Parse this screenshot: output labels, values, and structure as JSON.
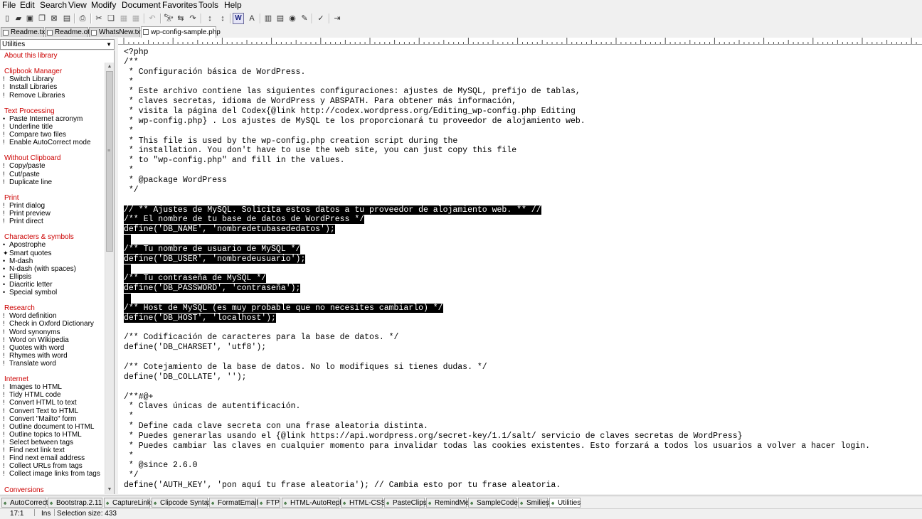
{
  "menu": [
    "File",
    "Edit",
    "Search",
    "View",
    "Modify",
    "Document",
    "Favorites",
    "Tools",
    "Help"
  ],
  "toolbar_icons": [
    "new-icon",
    "open-icon",
    "save-icon",
    "save-all-icon",
    "close-icon",
    "clipboard-icon",
    "print-icon",
    "cut-icon",
    "copy-icon",
    "paste-icon",
    "paste-special-icon",
    "undo-icon",
    "find-icon",
    "find-replace-icon",
    "find-next-icon",
    "sort-ascending-icon",
    "sort-descending-icon",
    "word-wrap-icon",
    "font-size-icon",
    "library-icon",
    "clipbook-icon",
    "web-icon",
    "edit-icon",
    "spell-check-icon",
    "exit-icon"
  ],
  "tabs": [
    "Readme.txt",
    "Readme.otl",
    "WhatsNew.txt",
    "wp-config-sample.php"
  ],
  "library": {
    "selected": "Utilities",
    "items": [
      {
        "type": "section",
        "text": "About this library"
      },
      {
        "type": "gap"
      },
      {
        "type": "section",
        "text": "Clipbook Manager"
      },
      {
        "type": "item",
        "bullet": "!",
        "text": "Switch Library"
      },
      {
        "type": "item",
        "bullet": "!",
        "text": "Install Libraries"
      },
      {
        "type": "item",
        "bullet": "!",
        "text": "Remove Libraries"
      },
      {
        "type": "gap"
      },
      {
        "type": "section",
        "text": "Text Processing"
      },
      {
        "type": "item",
        "bullet": "•",
        "text": "Paste Internet acronym"
      },
      {
        "type": "item",
        "bullet": "!",
        "text": "Underline title"
      },
      {
        "type": "item",
        "bullet": "!",
        "text": "Compare two files"
      },
      {
        "type": "item",
        "bullet": "!",
        "text": "Enable AutoCorrect mode"
      },
      {
        "type": "gap"
      },
      {
        "type": "section",
        "text": "Without Clipboard"
      },
      {
        "type": "item",
        "bullet": "!",
        "text": "Copy/paste"
      },
      {
        "type": "item",
        "bullet": "!",
        "text": "Cut/paste"
      },
      {
        "type": "item",
        "bullet": "!",
        "text": "Duplicate line"
      },
      {
        "type": "gap"
      },
      {
        "type": "section",
        "text": "Print"
      },
      {
        "type": "item",
        "bullet": "!",
        "text": "Print dialog"
      },
      {
        "type": "item",
        "bullet": "!",
        "text": "Print preview"
      },
      {
        "type": "item",
        "bullet": "!",
        "text": "Print direct"
      },
      {
        "type": "gap"
      },
      {
        "type": "section",
        "text": "Characters & symbols"
      },
      {
        "type": "item",
        "bullet": "•",
        "text": "Apostrophe"
      },
      {
        "type": "item",
        "bullet": "✦",
        "text": "Smart quotes"
      },
      {
        "type": "item",
        "bullet": "•",
        "text": "M-dash"
      },
      {
        "type": "item",
        "bullet": "•",
        "text": "N-dash (with spaces)"
      },
      {
        "type": "item",
        "bullet": "•",
        "text": "Ellipsis"
      },
      {
        "type": "item",
        "bullet": "•",
        "text": "Diacritic letter"
      },
      {
        "type": "item",
        "bullet": "•",
        "text": "Special symbol"
      },
      {
        "type": "gap"
      },
      {
        "type": "section",
        "text": "Research"
      },
      {
        "type": "item",
        "bullet": "!",
        "text": "Word definition"
      },
      {
        "type": "item",
        "bullet": "!",
        "text": "Check in Oxford Dictionary"
      },
      {
        "type": "item",
        "bullet": "!",
        "text": "Word synonyms"
      },
      {
        "type": "item",
        "bullet": "!",
        "text": "Word on Wikipedia"
      },
      {
        "type": "item",
        "bullet": "!",
        "text": "Quotes with word"
      },
      {
        "type": "item",
        "bullet": "!",
        "text": "Rhymes with word"
      },
      {
        "type": "item",
        "bullet": "!",
        "text": "Translate word"
      },
      {
        "type": "gap"
      },
      {
        "type": "section",
        "text": "Internet"
      },
      {
        "type": "item",
        "bullet": "!",
        "text": "Images to HTML"
      },
      {
        "type": "item",
        "bullet": "!",
        "text": "Tidy HTML code"
      },
      {
        "type": "item",
        "bullet": "!",
        "text": "Convert HTML to text"
      },
      {
        "type": "item",
        "bullet": "!",
        "text": "Convert Text to HTML"
      },
      {
        "type": "item",
        "bullet": "!",
        "text": "Convert \"Mailto\" form"
      },
      {
        "type": "item",
        "bullet": "!",
        "text": "Outline document to HTML"
      },
      {
        "type": "item",
        "bullet": "!",
        "text": "Outline topics to HTML"
      },
      {
        "type": "item",
        "bullet": "!",
        "text": "Select between tags"
      },
      {
        "type": "item",
        "bullet": "!",
        "text": "Find next link text"
      },
      {
        "type": "item",
        "bullet": "!",
        "text": "Find next email address"
      },
      {
        "type": "item",
        "bullet": "!",
        "text": "Collect URLs from tags"
      },
      {
        "type": "item",
        "bullet": "!",
        "text": "Collect image links from tags"
      },
      {
        "type": "gap"
      },
      {
        "type": "section",
        "text": "Conversions"
      }
    ]
  },
  "editor_lines": [
    {
      "t": "<?php"
    },
    {
      "t": "/**"
    },
    {
      "t": " * Configuración básica de WordPress."
    },
    {
      "t": " *"
    },
    {
      "t": " * Este archivo contiene las siguientes configuraciones: ajustes de MySQL, prefijo de tablas,"
    },
    {
      "t": " * claves secretas, idioma de WordPress y ABSPATH. Para obtener más información,"
    },
    {
      "t": " * visita la página del Codex{@link http://codex.wordpress.org/Editing_wp-config.php Editing"
    },
    {
      "t": " * wp-config.php} . Los ajustes de MySQL te los proporcionará tu proveedor de alojamiento web."
    },
    {
      "t": " *"
    },
    {
      "t": " * This file is used by the wp-config.php creation script during the"
    },
    {
      "t": " * installation. You don't have to use the web site, you can just copy this file"
    },
    {
      "t": " * to \"wp-config.php\" and fill in the values."
    },
    {
      "t": " *"
    },
    {
      "t": " * @package WordPress"
    },
    {
      "t": " */"
    },
    {
      "t": ""
    },
    {
      "t": "// ** Ajustes de MySQL. Solicita estos datos a tu proveedor de alojamiento web. ** //",
      "sel": true
    },
    {
      "t": "/** El nombre de tu base de datos de WordPress */",
      "sel": true
    },
    {
      "t": "define('DB_NAME', 'nombredetubasededatos');",
      "sel": true
    },
    {
      "t": "",
      "sel": true
    },
    {
      "t": "/** Tu nombre de usuario de MySQL */",
      "sel": true
    },
    {
      "t": "define('DB_USER', 'nombredeusuario');",
      "sel": true
    },
    {
      "t": "",
      "sel": true
    },
    {
      "t": "/** Tu contraseña de MySQL */",
      "sel": true
    },
    {
      "t": "define('DB_PASSWORD', 'contraseña');",
      "sel": true
    },
    {
      "t": "",
      "sel": true
    },
    {
      "t": "/** Host de MySQL (es muy probable que no necesites cambiarlo) */",
      "sel": true
    },
    {
      "t": "define('DB_HOST', 'localhost');",
      "sel": true
    },
    {
      "t": ""
    },
    {
      "t": "/** Codificación de caracteres para la base de datos. */"
    },
    {
      "t": "define('DB_CHARSET', 'utf8');"
    },
    {
      "t": ""
    },
    {
      "t": "/** Cotejamiento de la base de datos. No lo modifiques si tienes dudas. */"
    },
    {
      "t": "define('DB_COLLATE', '');"
    },
    {
      "t": ""
    },
    {
      "t": "/**#@+"
    },
    {
      "t": " * Claves únicas de autentificación."
    },
    {
      "t": " *"
    },
    {
      "t": " * Define cada clave secreta con una frase aleatoria distinta."
    },
    {
      "t": " * Puedes generarlas usando el {@link https://api.wordpress.org/secret-key/1.1/salt/ servicio de claves secretas de WordPress}"
    },
    {
      "t": " * Puedes cambiar las claves en cualquier momento para invalidar todas las cookies existentes. Esto forzará a todos los usuarios a volver a hacer login."
    },
    {
      "t": " *"
    },
    {
      "t": " * @since 2.6.0"
    },
    {
      "t": " */"
    },
    {
      "t": "define('AUTH_KEY', 'pon aquí tu frase aleatoria'); // Cambia esto por tu frase aleatoria."
    }
  ],
  "bottom_tabs": [
    "AutoCorrect",
    "Bootstrap.2.11",
    "CaptureLinks",
    "Clipcode Syntax",
    "FormatEmail",
    "FTP",
    "HTML-AutoReplace",
    "HTML-CSS",
    "PasteClips",
    "RemindMe",
    "SampleCode",
    "Smilies",
    "Utilities"
  ],
  "status": {
    "position": "17:1",
    "mode": "Ins",
    "selection": "Selection size: 433"
  }
}
